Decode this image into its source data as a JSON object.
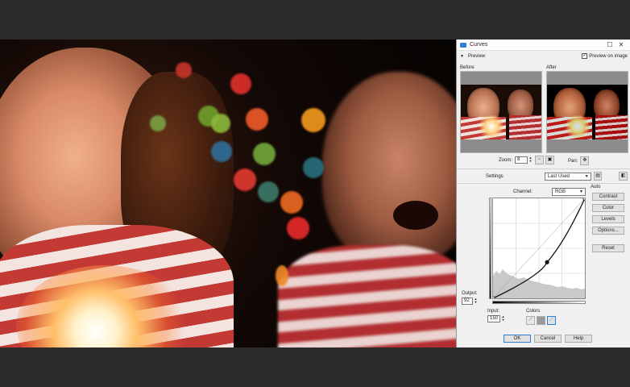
{
  "window": {
    "title": "Curves",
    "maximize_glyph": "☐",
    "close_glyph": "✕",
    "accent_color": "#2e7fd6"
  },
  "preview": {
    "section_label": "Preview",
    "preview_on_image_label": "Preview on image",
    "preview_on_image_checked": true,
    "before_label": "Before",
    "after_label": "After",
    "zoom_label": "Zoom:",
    "zoom_value": "8",
    "pan_label": "Pan:"
  },
  "settings": {
    "label": "Settings",
    "preset_value": "Last Used"
  },
  "channel": {
    "label": "Channel:",
    "value": "RGB"
  },
  "auto": {
    "label": "Auto",
    "contrast_label": "Contrast",
    "color_label": "Color",
    "levels_label": "Levels",
    "options_label": "Options...",
    "reset_label": "Reset"
  },
  "io": {
    "output_label": "Output:",
    "output_value": "92",
    "input_label": "Input:",
    "input_value": "150",
    "colors_label": "Colors"
  },
  "curve": {
    "points": [
      [
        0,
        0
      ],
      [
        150,
        92
      ],
      [
        255,
        255
      ]
    ],
    "selected_point": [
      150,
      92
    ],
    "range": [
      0,
      255
    ]
  },
  "footer": {
    "ok_label": "OK",
    "cancel_label": "Cancel",
    "help_label": "Help"
  }
}
